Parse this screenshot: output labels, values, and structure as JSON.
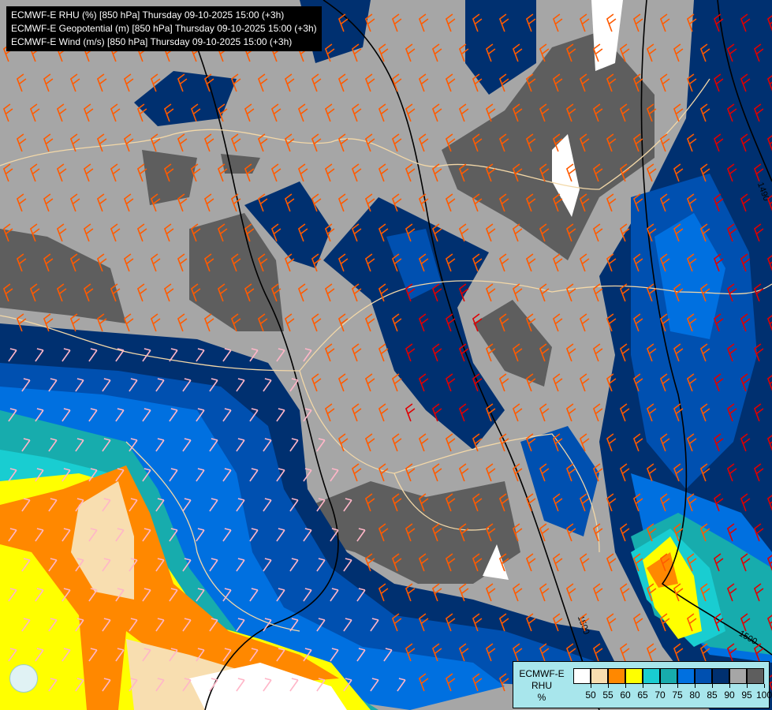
{
  "header": {
    "lines": [
      "ECMWF-E RHU (%) [850 hPa] Thursday 09-10-2025 15:00 (+3h)",
      "ECMWF-E Geopotential (m) [850 hPa] Thursday 09-10-2025 15:00 (+3h)",
      "ECMWF-E Wind (m/s) [850 hPa] Thursday 09-10-2025 15:00 (+3h)"
    ]
  },
  "map": {
    "contour_labels": [
      "1490",
      "1500",
      "1500"
    ],
    "colors": {
      "50": "#ffffff",
      "55": "#f8deb0",
      "60": "#ff8800",
      "65": "#ffff00",
      "70": "#19cdd1",
      "75": "#17acad",
      "80": "#0070e0",
      "85": "#0050b0",
      "90": "#003070",
      "95": "#a6a6a6",
      "100": "#5e5e5e"
    }
  },
  "legend": {
    "title_lines": [
      "ECMWF-E",
      "RHU",
      "%"
    ],
    "swatches": [
      "#ffffff",
      "#f8deb0",
      "#ff8800",
      "#ffff00",
      "#19cdd1",
      "#17acad",
      "#0070e0",
      "#0050b0",
      "#003070",
      "#a6a6a6",
      "#5e5e5e"
    ],
    "ticks": [
      "50",
      "55",
      "60",
      "65",
      "70",
      "75",
      "80",
      "85",
      "90",
      "95",
      "100"
    ]
  }
}
